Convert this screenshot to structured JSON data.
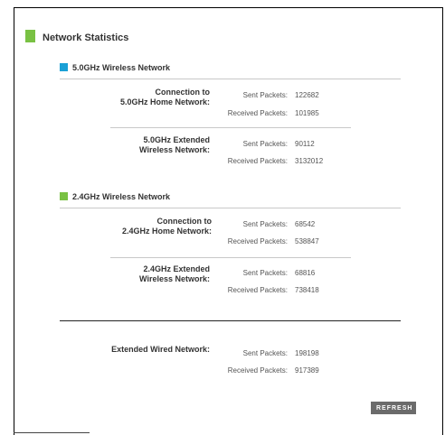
{
  "page": {
    "title": "Network Statistics",
    "accent_color": "#79c143"
  },
  "sections": {
    "g5": {
      "title": "5.0GHz Wireless Network",
      "color": "#1aa0d6",
      "home": {
        "label_line1": "Connection to",
        "label_line2": "5.0GHz Home Network:",
        "sent_label": "Sent Packets:",
        "sent_value": "122682",
        "recv_label": "Received Packets:",
        "recv_value": "101985"
      },
      "extended": {
        "label_line1": "5.0GHz Extended",
        "label_line2": "Wireless Network:",
        "sent_label": "Sent Packets:",
        "sent_value": "90112",
        "recv_label": "Received Packets:",
        "recv_value": "3132012"
      }
    },
    "g24": {
      "title": "2.4GHz Wireless Network",
      "color": "#79c143",
      "home": {
        "label_line1": "Connection to",
        "label_line2": "2.4GHz Home Network:",
        "sent_label": "Sent Packets:",
        "sent_value": "68542",
        "recv_label": "Received Packets:",
        "recv_value": "538847"
      },
      "extended": {
        "label_line1": "2.4GHz Extended",
        "label_line2": "Wireless Network:",
        "sent_label": "Sent Packets:",
        "sent_value": "68816",
        "recv_label": "Received Packets:",
        "recv_value": "738418"
      }
    },
    "wired": {
      "label": "Extended Wired Network:",
      "sent_label": "Sent Packets:",
      "sent_value": "198198",
      "recv_label": "Received Packets:",
      "recv_value": "917389"
    }
  },
  "buttons": {
    "refresh": "REFRESH"
  }
}
